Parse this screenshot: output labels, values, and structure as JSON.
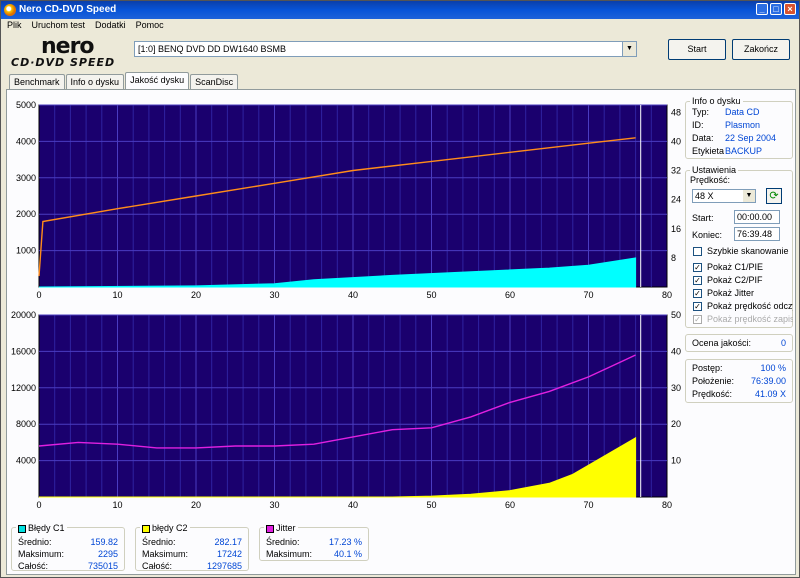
{
  "window": {
    "title": "Nero CD-DVD Speed"
  },
  "menu": [
    "Plik",
    "Uruchom test",
    "Dodatki",
    "Pomoc"
  ],
  "logo": {
    "line1": "nero",
    "line2": "CD·DVD SPEED"
  },
  "drive": {
    "selected": "[1:0]   BENQ DVD DD DW1640 BSMB"
  },
  "buttons": {
    "start": "Start",
    "stop": "Zakończ"
  },
  "tabs": [
    "Benchmark",
    "Info o dysku",
    "Jakość dysku",
    "ScanDisc"
  ],
  "active_tab": "Jakość dysku",
  "disc_info": {
    "title": "Info o dysku",
    "rows": [
      {
        "label": "Typ:",
        "value": "Data CD"
      },
      {
        "label": "ID:",
        "value": "Plasmon"
      },
      {
        "label": "Data:",
        "value": "22 Sep 2004"
      },
      {
        "label": "Etykieta",
        "value": "BACKUP"
      }
    ]
  },
  "settings": {
    "title": "Ustawienia",
    "speed_label": "Prędkość:",
    "speed_value": "48 X",
    "start_label": "Start:",
    "start_value": "00:00.00",
    "end_label": "Koniec:",
    "end_value": "76:39.48",
    "checks": [
      {
        "label": "Szybkie skanowanie",
        "checked": false,
        "disabled": false
      },
      {
        "label": "Pokaż C1/PIE",
        "checked": true,
        "disabled": false
      },
      {
        "label": "Pokaż C2/PIF",
        "checked": true,
        "disabled": false
      },
      {
        "label": "Pokaż Jitter",
        "checked": true,
        "disabled": false
      },
      {
        "label": "Pokaż prędkość odczytu",
        "checked": true,
        "disabled": false
      },
      {
        "label": "Pokaż prędkość zapisu",
        "checked": true,
        "disabled": true
      }
    ]
  },
  "quality": {
    "label": "Ocena jakości:",
    "value": "0"
  },
  "progress": {
    "rows": [
      {
        "label": "Postęp:",
        "value": "100 %"
      },
      {
        "label": "Położenie:",
        "value": "76:39.00"
      },
      {
        "label": "Prędkość:",
        "value": "41.09 X"
      }
    ]
  },
  "stats": [
    {
      "title": "Błędy C1",
      "color": "#00e0e0",
      "rows": [
        [
          "Średnio:",
          "159.82"
        ],
        [
          "Maksimum:",
          "2295"
        ],
        [
          "Całość:",
          "735015"
        ]
      ]
    },
    {
      "title": "błędy C2",
      "color": "#ffff00",
      "rows": [
        [
          "Średnio:",
          "282.17"
        ],
        [
          "Maksimum:",
          "17242"
        ],
        [
          "Całość:",
          "1297685"
        ]
      ]
    },
    {
      "title": "Jitter",
      "color": "#e020e0",
      "rows": [
        [
          "Średnio:",
          "17.23 %"
        ],
        [
          "Maksimum:",
          "40.1 %"
        ]
      ]
    }
  ],
  "chart_data": [
    {
      "type": "line",
      "plot_bg": "#1a006e",
      "xlim": [
        0,
        80
      ],
      "ylim_left": [
        0,
        5000
      ],
      "ylim_right": [
        0,
        50
      ],
      "x_ticks": [
        "0",
        "10",
        "20",
        "30",
        "40",
        "50",
        "60",
        "70",
        "80"
      ],
      "y_ticks_left": [
        "1000",
        "2000",
        "3000",
        "4000",
        "5000"
      ],
      "y_ticks_right": [
        "8",
        "16",
        "24",
        "32",
        "40",
        "48"
      ],
      "series": [
        {
          "color": "#ff8c1a",
          "axis": "right",
          "x": [
            0,
            0.5,
            10,
            20,
            30,
            40,
            50,
            60,
            70,
            76
          ],
          "y": [
            3,
            18,
            21.5,
            25,
            28.5,
            32,
            34.5,
            37,
            39.5,
            41
          ]
        },
        {
          "color": "#00ffff",
          "axis": "left",
          "x": [
            0,
            20,
            30,
            35,
            45,
            55,
            65,
            70,
            76
          ],
          "y": [
            0,
            30,
            90,
            200,
            320,
            420,
            520,
            600,
            800
          ]
        }
      ]
    },
    {
      "type": "line",
      "plot_bg": "#1a006e",
      "xlim": [
        0,
        80
      ],
      "ylim_left": [
        0,
        20000
      ],
      "ylim_right": [
        0,
        50
      ],
      "x_ticks": [
        "0",
        "10",
        "20",
        "30",
        "40",
        "50",
        "60",
        "70",
        "80"
      ],
      "y_ticks_left": [
        "4000",
        "8000",
        "12000",
        "16000",
        "20000"
      ],
      "y_ticks_right": [
        "10",
        "20",
        "30",
        "40",
        "50"
      ],
      "series": [
        {
          "color": "#e020e0",
          "axis": "right",
          "x": [
            0,
            5,
            10,
            15,
            20,
            25,
            30,
            35,
            40,
            45,
            50,
            55,
            60,
            65,
            70,
            73,
            76
          ],
          "y": [
            14,
            15,
            14.5,
            13.5,
            13.5,
            14,
            14,
            14.5,
            16.5,
            18.5,
            19,
            22,
            26,
            29,
            33,
            36,
            39
          ]
        },
        {
          "color": "#ffff00",
          "axis": "left",
          "x": [
            0,
            45,
            50,
            55,
            60,
            65,
            68,
            70,
            72,
            74,
            76
          ],
          "y": [
            0,
            0,
            100,
            300,
            700,
            1500,
            2500,
            3500,
            4500,
            5500,
            6500
          ]
        }
      ]
    }
  ]
}
